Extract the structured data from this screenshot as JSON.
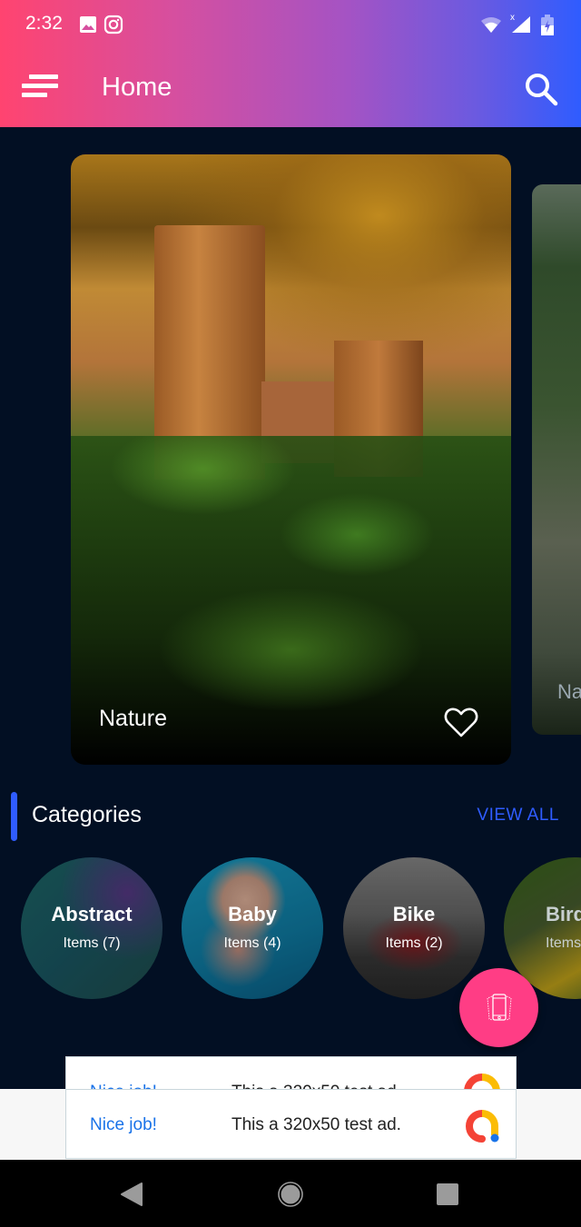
{
  "status_bar": {
    "time": "2:32",
    "left_icons": [
      "image-icon",
      "instagram-icon"
    ],
    "right_icons": [
      "wifi-icon",
      "signal-icon",
      "battery-charging-icon"
    ]
  },
  "app_bar": {
    "title": "Home",
    "menu_icon": "menu-icon",
    "search_icon": "search-icon",
    "gradient": [
      "#ff4470",
      "#2f5cff"
    ]
  },
  "featured": {
    "cards": [
      {
        "title": "Nature",
        "favorite": false
      },
      {
        "title": "Nature"
      }
    ]
  },
  "categories": {
    "title": "Categories",
    "view_all_label": "VIEW ALL",
    "accent": "#2f5cff",
    "items": [
      {
        "name": "Abstract",
        "count": "Items (7)"
      },
      {
        "name": "Baby",
        "count": "Items (4)"
      },
      {
        "name": "Bike",
        "count": "Items (2)"
      },
      {
        "name": "Birds",
        "count": "Items"
      }
    ]
  },
  "fab": {
    "icon": "phone-rotate-icon",
    "color": "#ff3d85"
  },
  "ads": [
    {
      "headline": "Nice job!",
      "text": "This a 320x50 test ad."
    },
    {
      "headline": "Nice job!",
      "text": "This a 320x50 test ad."
    }
  ],
  "nav_bar": {
    "buttons": [
      "back",
      "home",
      "recents"
    ]
  }
}
